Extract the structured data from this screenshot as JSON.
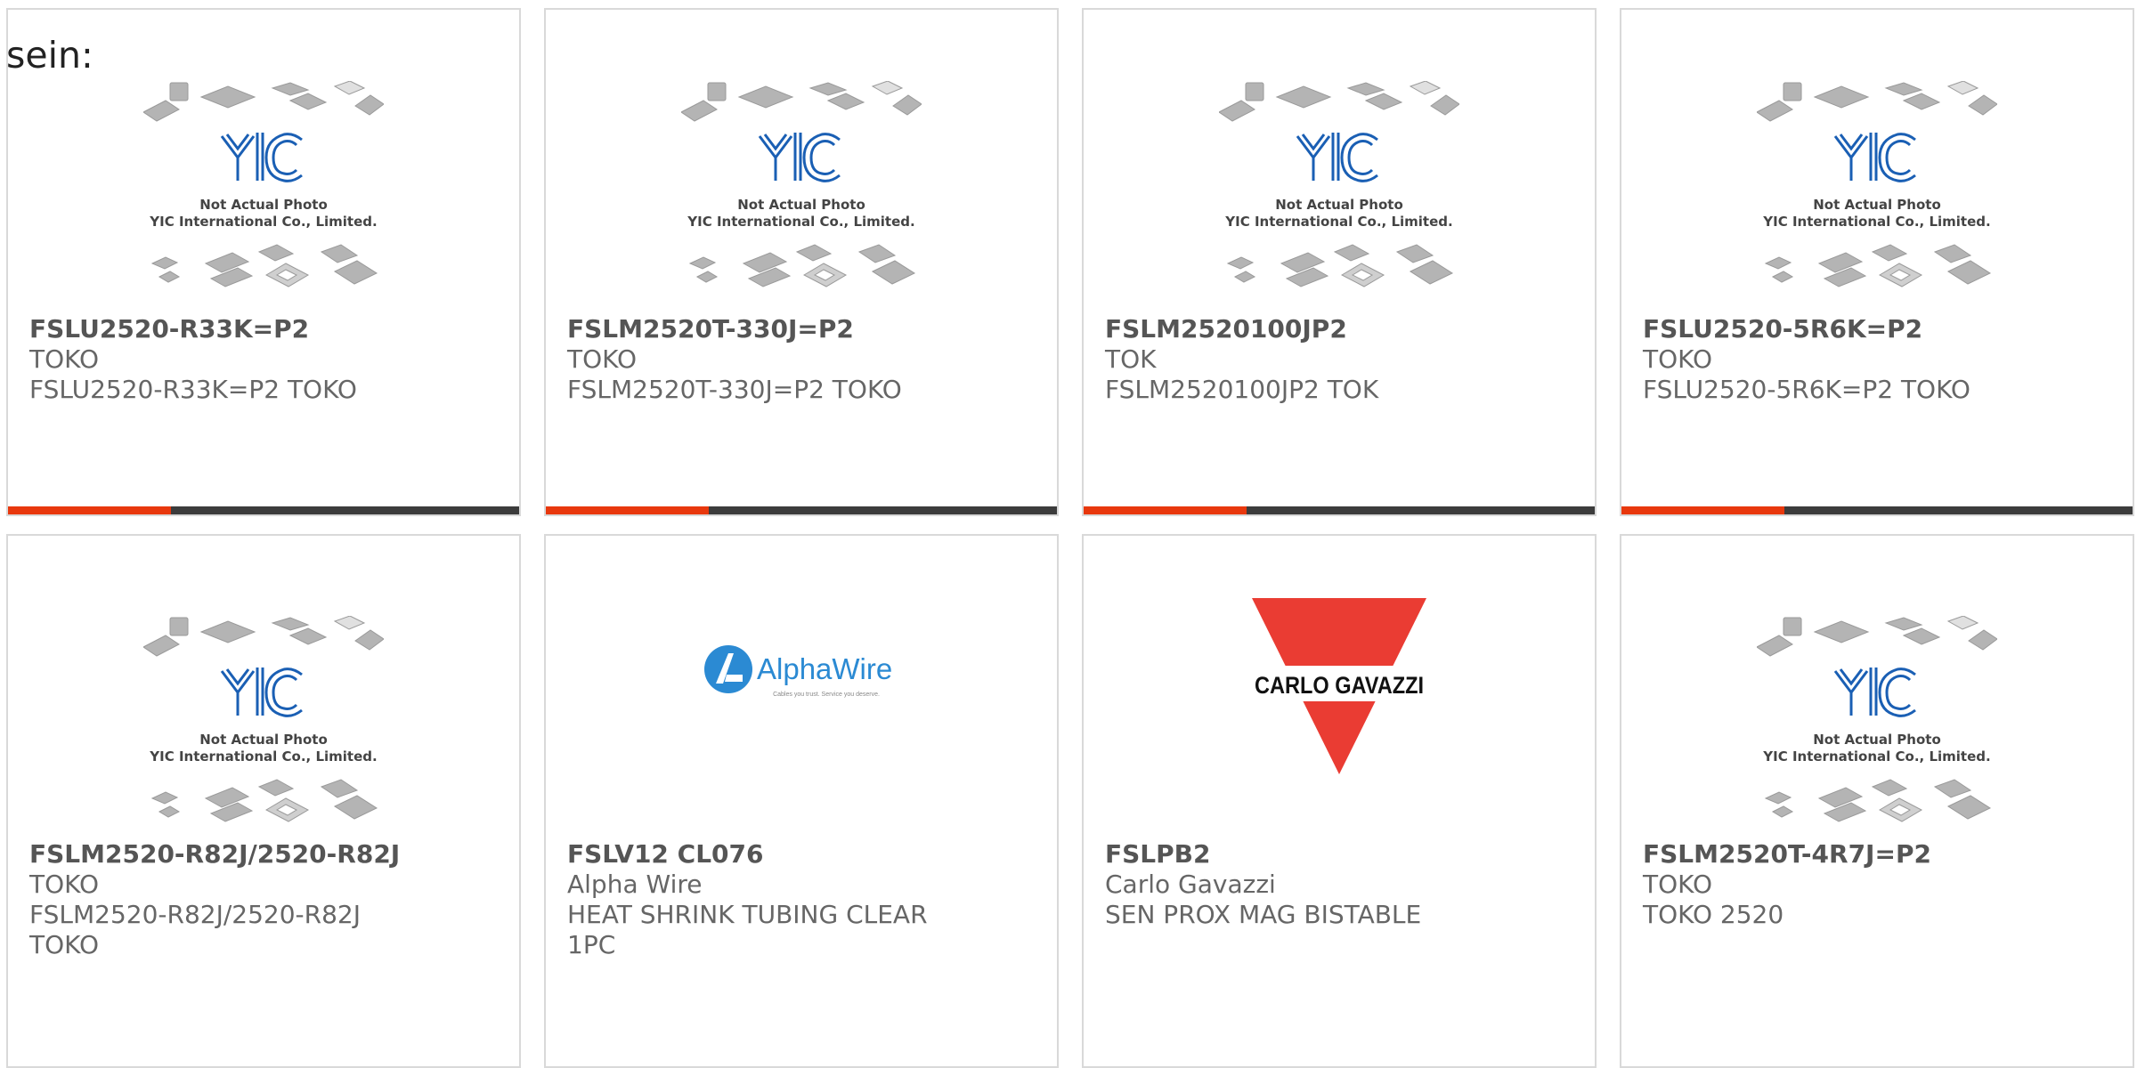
{
  "lead_text": "sein:",
  "colors": {
    "accent": "#e8380d",
    "bar_dark": "#3c3c3c",
    "yic_blue": "#1a5fb4",
    "carlo_red": "#ea3c33"
  },
  "placeholder": {
    "line1": "Not Actual Photo",
    "line2": "YIC International Co., Limited.",
    "logo_text": "YIC"
  },
  "products": [
    {
      "part": "FSLU2520-R33K=P2",
      "manufacturer": "TOKO",
      "description": "FSLU2520-R33K=P2 TOKO",
      "image": "yic-placeholder"
    },
    {
      "part": "FSLM2520T-330J=P2",
      "manufacturer": "TOKO",
      "description": "FSLM2520T-330J=P2 TOKO",
      "image": "yic-placeholder"
    },
    {
      "part": "FSLM2520100JP2",
      "manufacturer": "TOK",
      "description": "FSLM2520100JP2 TOK",
      "image": "yic-placeholder"
    },
    {
      "part": "FSLU2520-5R6K=P2",
      "manufacturer": "TOKO",
      "description": "FSLU2520-5R6K=P2 TOKO",
      "image": "yic-placeholder"
    },
    {
      "part": "FSLM2520-R82J/2520-R82J",
      "manufacturer": "TOKO",
      "description": "FSLM2520-R82J/2520-R82J TOKO",
      "image": "yic-placeholder"
    },
    {
      "part": "FSLV12 CL076",
      "manufacturer": "Alpha Wire",
      "description": "HEAT SHRINK TUBING CLEAR 1PC",
      "image": "alphawire-logo"
    },
    {
      "part": "FSLPB2",
      "manufacturer": "Carlo Gavazzi",
      "description": "SEN PROX MAG BISTABLE",
      "image": "carlo-gavazzi-logo"
    },
    {
      "part": "FSLM2520T-4R7J=P2",
      "manufacturer": "TOKO",
      "description": "TOKO 2520",
      "image": "yic-placeholder"
    }
  ],
  "logos": {
    "alphawire": {
      "name": "AlphaWire",
      "tagline": "Cables you trust. Service you deserve."
    },
    "carlo": {
      "name": "CARLO GAVAZZI"
    }
  }
}
